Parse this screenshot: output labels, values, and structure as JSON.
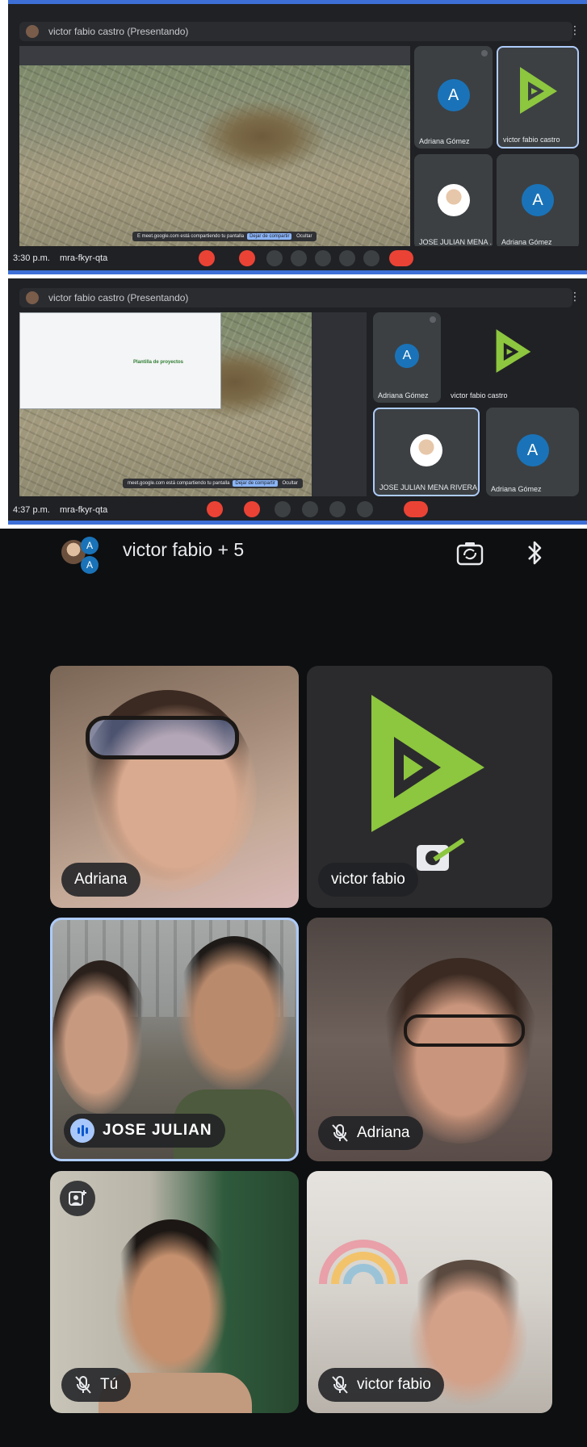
{
  "screenshots": [
    {
      "window_title": "victor fabio castro (Presentando)",
      "meeting_time": "3:30 p.m.",
      "meeting_code": "mra-fkyr-qta",
      "share_toast": "E meet.google.com está compartiendo tu pantalla",
      "share_toast_action": "Dejar de compartir",
      "share_toast_hide": "Ocultar",
      "participants": [
        "Adriana Gómez",
        "victor fabio castro",
        "JOSE JULIAN MENA ...",
        "Adriana Gómez"
      ]
    },
    {
      "window_title": "victor fabio castro (Presentando)",
      "meeting_time": "4:37 p.m.",
      "meeting_code": "mra-fkyr-qta",
      "share_toast": "meet.google.com está compartiendo tu pantalla",
      "share_toast_action": "Dejar de compartir",
      "share_toast_hide": "Ocultar",
      "doc_title": "Plantilla de proyectos",
      "participants": [
        "Adriana Gómez",
        "victor fabio castro",
        "JOSE JULIAN MENA RIVERA",
        "Adriana Gómez"
      ]
    }
  ],
  "avatar_letter": "A",
  "mobile": {
    "call_title": "victor fabio + 5",
    "tiles": [
      {
        "name": "Adriana",
        "muted": false,
        "speaking": false
      },
      {
        "name": "victor fabio",
        "muted": false,
        "speaking": false
      },
      {
        "name": "JOSE JULIAN",
        "muted": false,
        "speaking": true
      },
      {
        "name": "Adriana",
        "muted": true,
        "speaking": false
      },
      {
        "name": "Tú",
        "muted": true,
        "speaking": false
      },
      {
        "name": "victor fabio",
        "muted": true,
        "speaking": false
      }
    ],
    "colors": {
      "background": "#0e0f11",
      "tile": "#2b2b2d",
      "speaking_border": "#aecbfa",
      "logo_green": "#8dc63f"
    }
  }
}
